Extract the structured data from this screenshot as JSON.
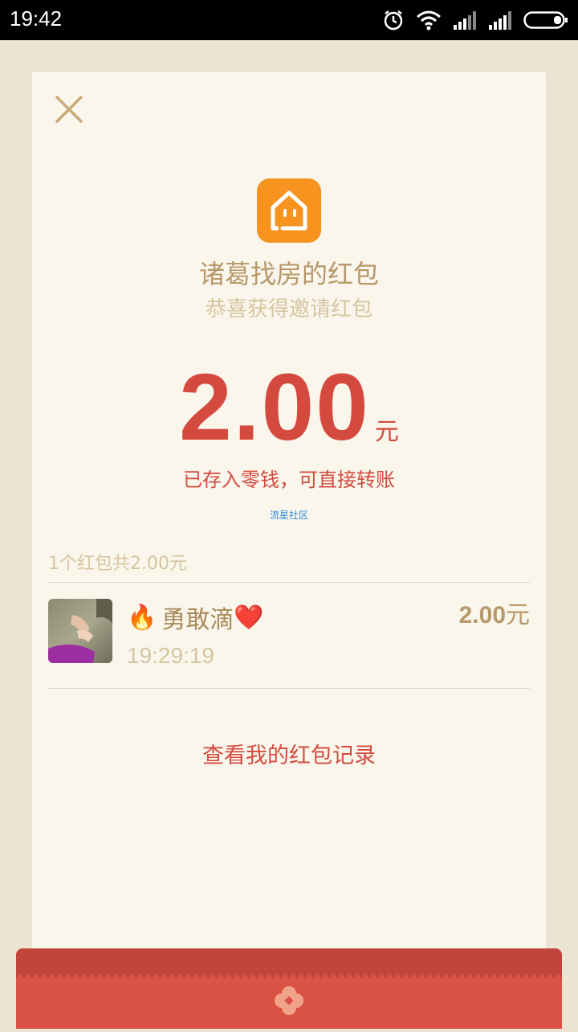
{
  "status_bar": {
    "time": "19:42",
    "icons": [
      "alarm-icon",
      "wifi-icon",
      "signal-icon",
      "signal-icon",
      "battery-icon"
    ]
  },
  "card": {
    "close_icon": "close-icon",
    "app_logo_icon": "house-face-icon",
    "title": "诸葛找房的红包",
    "subtitle": "恭喜获得邀请红包",
    "amount": "2.00",
    "amount_unit": "元",
    "stored_note": "已存入零钱，可直接转账",
    "watermark": "流星社区",
    "summary": "1个红包共2.00元",
    "records": [
      {
        "name_prefix_emoji": "🔥",
        "name": "勇敢滴",
        "name_suffix_emoji": "❤️",
        "time": "19:29:19",
        "amount": "2.00",
        "unit": "元"
      }
    ],
    "history_link": "查看我的红包记录"
  },
  "colors": {
    "background": "#ece4d3",
    "card": "#faf6ec",
    "accent_red": "#d44a3f",
    "gold": "#b7986a",
    "light_gold": "#d7c5a1",
    "logo_orange": "#f7931e"
  }
}
